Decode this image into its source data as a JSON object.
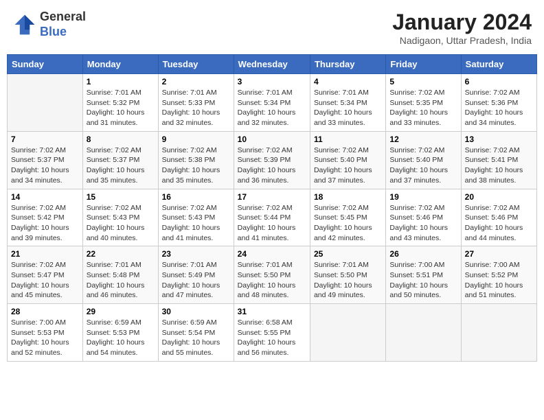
{
  "header": {
    "logo_general": "General",
    "logo_blue": "Blue",
    "month_title": "January 2024",
    "subtitle": "Nadigaon, Uttar Pradesh, India"
  },
  "days_of_week": [
    "Sunday",
    "Monday",
    "Tuesday",
    "Wednesday",
    "Thursday",
    "Friday",
    "Saturday"
  ],
  "weeks": [
    [
      {
        "day": "",
        "info": ""
      },
      {
        "day": "1",
        "info": "Sunrise: 7:01 AM\nSunset: 5:32 PM\nDaylight: 10 hours\nand 31 minutes."
      },
      {
        "day": "2",
        "info": "Sunrise: 7:01 AM\nSunset: 5:33 PM\nDaylight: 10 hours\nand 32 minutes."
      },
      {
        "day": "3",
        "info": "Sunrise: 7:01 AM\nSunset: 5:34 PM\nDaylight: 10 hours\nand 32 minutes."
      },
      {
        "day": "4",
        "info": "Sunrise: 7:01 AM\nSunset: 5:34 PM\nDaylight: 10 hours\nand 33 minutes."
      },
      {
        "day": "5",
        "info": "Sunrise: 7:02 AM\nSunset: 5:35 PM\nDaylight: 10 hours\nand 33 minutes."
      },
      {
        "day": "6",
        "info": "Sunrise: 7:02 AM\nSunset: 5:36 PM\nDaylight: 10 hours\nand 34 minutes."
      }
    ],
    [
      {
        "day": "7",
        "info": "Sunrise: 7:02 AM\nSunset: 5:37 PM\nDaylight: 10 hours\nand 34 minutes."
      },
      {
        "day": "8",
        "info": "Sunrise: 7:02 AM\nSunset: 5:37 PM\nDaylight: 10 hours\nand 35 minutes."
      },
      {
        "day": "9",
        "info": "Sunrise: 7:02 AM\nSunset: 5:38 PM\nDaylight: 10 hours\nand 35 minutes."
      },
      {
        "day": "10",
        "info": "Sunrise: 7:02 AM\nSunset: 5:39 PM\nDaylight: 10 hours\nand 36 minutes."
      },
      {
        "day": "11",
        "info": "Sunrise: 7:02 AM\nSunset: 5:40 PM\nDaylight: 10 hours\nand 37 minutes."
      },
      {
        "day": "12",
        "info": "Sunrise: 7:02 AM\nSunset: 5:40 PM\nDaylight: 10 hours\nand 37 minutes."
      },
      {
        "day": "13",
        "info": "Sunrise: 7:02 AM\nSunset: 5:41 PM\nDaylight: 10 hours\nand 38 minutes."
      }
    ],
    [
      {
        "day": "14",
        "info": "Sunrise: 7:02 AM\nSunset: 5:42 PM\nDaylight: 10 hours\nand 39 minutes."
      },
      {
        "day": "15",
        "info": "Sunrise: 7:02 AM\nSunset: 5:43 PM\nDaylight: 10 hours\nand 40 minutes."
      },
      {
        "day": "16",
        "info": "Sunrise: 7:02 AM\nSunset: 5:43 PM\nDaylight: 10 hours\nand 41 minutes."
      },
      {
        "day": "17",
        "info": "Sunrise: 7:02 AM\nSunset: 5:44 PM\nDaylight: 10 hours\nand 41 minutes."
      },
      {
        "day": "18",
        "info": "Sunrise: 7:02 AM\nSunset: 5:45 PM\nDaylight: 10 hours\nand 42 minutes."
      },
      {
        "day": "19",
        "info": "Sunrise: 7:02 AM\nSunset: 5:46 PM\nDaylight: 10 hours\nand 43 minutes."
      },
      {
        "day": "20",
        "info": "Sunrise: 7:02 AM\nSunset: 5:46 PM\nDaylight: 10 hours\nand 44 minutes."
      }
    ],
    [
      {
        "day": "21",
        "info": "Sunrise: 7:02 AM\nSunset: 5:47 PM\nDaylight: 10 hours\nand 45 minutes."
      },
      {
        "day": "22",
        "info": "Sunrise: 7:01 AM\nSunset: 5:48 PM\nDaylight: 10 hours\nand 46 minutes."
      },
      {
        "day": "23",
        "info": "Sunrise: 7:01 AM\nSunset: 5:49 PM\nDaylight: 10 hours\nand 47 minutes."
      },
      {
        "day": "24",
        "info": "Sunrise: 7:01 AM\nSunset: 5:50 PM\nDaylight: 10 hours\nand 48 minutes."
      },
      {
        "day": "25",
        "info": "Sunrise: 7:01 AM\nSunset: 5:50 PM\nDaylight: 10 hours\nand 49 minutes."
      },
      {
        "day": "26",
        "info": "Sunrise: 7:00 AM\nSunset: 5:51 PM\nDaylight: 10 hours\nand 50 minutes."
      },
      {
        "day": "27",
        "info": "Sunrise: 7:00 AM\nSunset: 5:52 PM\nDaylight: 10 hours\nand 51 minutes."
      }
    ],
    [
      {
        "day": "28",
        "info": "Sunrise: 7:00 AM\nSunset: 5:53 PM\nDaylight: 10 hours\nand 52 minutes."
      },
      {
        "day": "29",
        "info": "Sunrise: 6:59 AM\nSunset: 5:53 PM\nDaylight: 10 hours\nand 54 minutes."
      },
      {
        "day": "30",
        "info": "Sunrise: 6:59 AM\nSunset: 5:54 PM\nDaylight: 10 hours\nand 55 minutes."
      },
      {
        "day": "31",
        "info": "Sunrise: 6:58 AM\nSunset: 5:55 PM\nDaylight: 10 hours\nand 56 minutes."
      },
      {
        "day": "",
        "info": ""
      },
      {
        "day": "",
        "info": ""
      },
      {
        "day": "",
        "info": ""
      }
    ]
  ]
}
